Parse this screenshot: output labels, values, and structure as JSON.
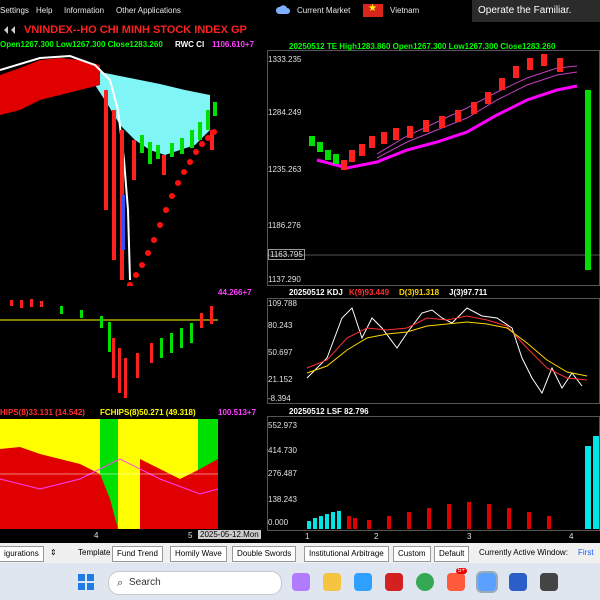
{
  "menu": {
    "items": [
      "Settings",
      "Help",
      "Information",
      "Other Applications"
    ],
    "current_market": "Current Market",
    "country": "Vietnam",
    "window_title": "Operate the Familiar."
  },
  "toolbar": {
    "chart_title": "VNINDEX--HO CHI MINH STOCK INDEX GP"
  },
  "panels": {
    "left_top": {
      "ohlc": "Open1267.300 Low1267.300 Close1283.260",
      "indicator": "RWC CI",
      "value": "1106.610+7"
    },
    "right_top": {
      "header": "20250512 TE High1283.860 Open1267.300 Low1267.300 Close1283.260",
      "yticks": [
        "1333.235",
        "1284.249",
        "1235.263",
        "1186.276",
        "1163.795",
        "1137.290"
      ]
    },
    "left_mid": {
      "value": "44.266+7"
    },
    "right_mid": {
      "date": "20250512 KDJ",
      "k": "K(9)93.449",
      "d": "D(3)91.318",
      "j": "J(3)97.711",
      "yticks": [
        "109.788",
        "80.243",
        "50.697",
        "21.152",
        "-8.394"
      ]
    },
    "left_bot": {
      "series1": "HIPS(8)33.131 (14.542)",
      "series2": "FCHIPS(8)50.271 (49.318)",
      "value": "100.513+7",
      "xticks": [
        "4",
        "5"
      ],
      "date_label": "2025-05-12.Mon"
    },
    "right_bot": {
      "header": "20250512 LSF 82.796",
      "yticks": [
        "552.973",
        "414.730",
        "276.487",
        "138.243",
        "0.000"
      ],
      "xticks": [
        "1",
        "2",
        "3",
        "4"
      ]
    }
  },
  "bottom_tabs": {
    "configurations": "igurations",
    "template": "Template",
    "tabs": [
      "Fund Trend",
      "Homily Wave",
      "Double Swords",
      "Institutional Arbitrage",
      "Custom",
      "Default"
    ],
    "active_window_label": "Currently Active Window:",
    "active_window_value": "First W"
  },
  "taskbar": {
    "search_placeholder": "Search",
    "badge": "5+"
  },
  "colors": {
    "up": "#ff2020",
    "down": "#00e000",
    "cyan": "#7ff5f5",
    "magenta": "#ff00ff",
    "yellow": "#ffff00"
  }
}
